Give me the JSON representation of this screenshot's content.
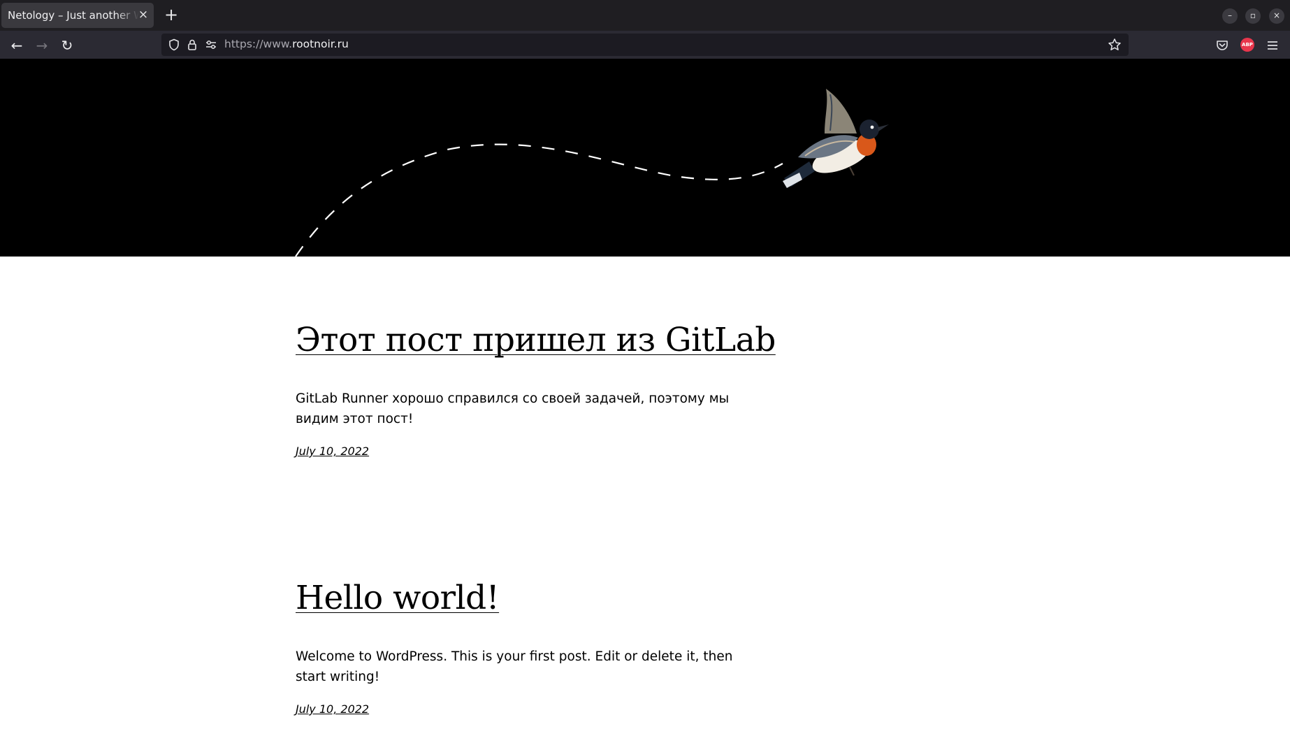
{
  "browser": {
    "tab": {
      "title": "Netology – Just another WordPress site",
      "close_glyph": "×"
    },
    "new_tab_glyph": "+",
    "window_controls": {
      "minimize": "–",
      "maximize": "▫",
      "close": "×"
    },
    "nav": {
      "back": "←",
      "forward": "→",
      "reload": "↻"
    },
    "url": {
      "prefix": "https://www.",
      "host": "rootnoir.ru"
    },
    "icons": [
      "shield-icon",
      "lock-icon",
      "permissions-icon",
      "bookmark-star-icon",
      "pocket-icon",
      "adblock-plus-icon",
      "hamburger-menu-icon"
    ],
    "abp_label": "ABP"
  },
  "page": {
    "header_background": "#000000",
    "posts": [
      {
        "title": "Этот пост пришел из GitLab",
        "excerpt": "GitLab Runner хорошо справился со своей задачей, поэтому мы видим этот пост!",
        "date": "July 10, 2022"
      },
      {
        "title": "Hello world!",
        "excerpt": "Welcome to WordPress. This is your first post. Edit or delete it, then start writing!",
        "date": "July 10, 2022"
      }
    ]
  }
}
